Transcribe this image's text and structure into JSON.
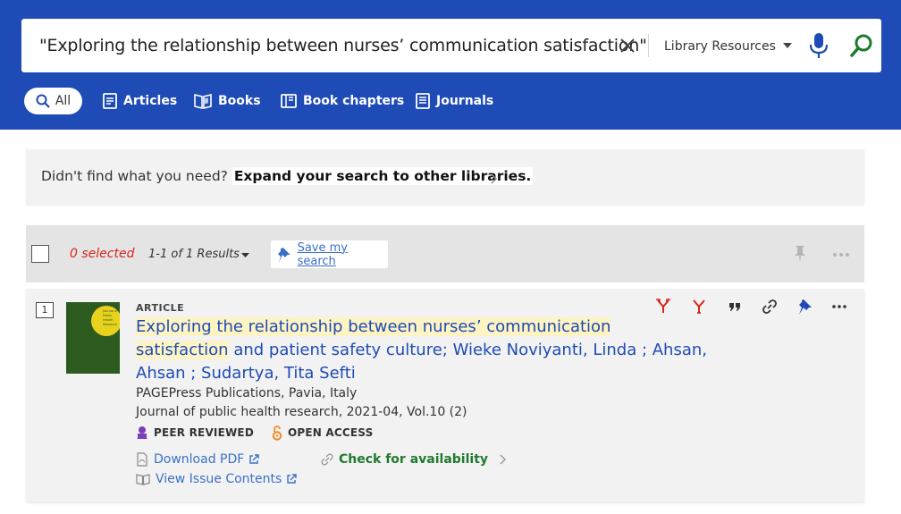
{
  "search": {
    "query": "\"Exploring the relationship between nurses’ communication satisfaction\"",
    "scope": "Library Resources"
  },
  "tabs": [
    {
      "label": "All"
    },
    {
      "label": "Articles"
    },
    {
      "label": "Books"
    },
    {
      "label": "Book chapters"
    },
    {
      "label": "Journals"
    }
  ],
  "banner": {
    "prefix": "Didn't find what you need?",
    "link": "Expand your search to other libraries."
  },
  "toolbar": {
    "selected": "0 selected",
    "results": "1-1 of 1 Results",
    "save_search": "Save my search"
  },
  "result": {
    "number": "1",
    "type": "ARTICLE",
    "title_highlight": "Exploring the relationship between nurses’ communication satisfaction",
    "title_rest": " and patient safety culture; Wieke Noviyanti, Linda ; Ahsan, Ahsan ; Sudartya, Tita Sefti",
    "thumb_text": "Journal of Public Health Research",
    "publisher": "PAGEPress Publications, Pavia, Italy",
    "journal": "Journal of public health research, 2021-04, Vol.10 (2)",
    "badge_peer": "PEER REVIEWED",
    "badge_open": "OPEN ACCESS",
    "download_pdf": "Download PDF",
    "view_issue": "View Issue Contents",
    "availability": "Check for availability"
  },
  "colors": {
    "header_bg": "#1e4bb5",
    "link_blue": "#3a6fc9",
    "availability_green": "#1f7a2d",
    "selected_red": "#d9251b",
    "open_access_orange": "#f08a24",
    "peer_reviewed_purple": "#7b3fb8"
  }
}
